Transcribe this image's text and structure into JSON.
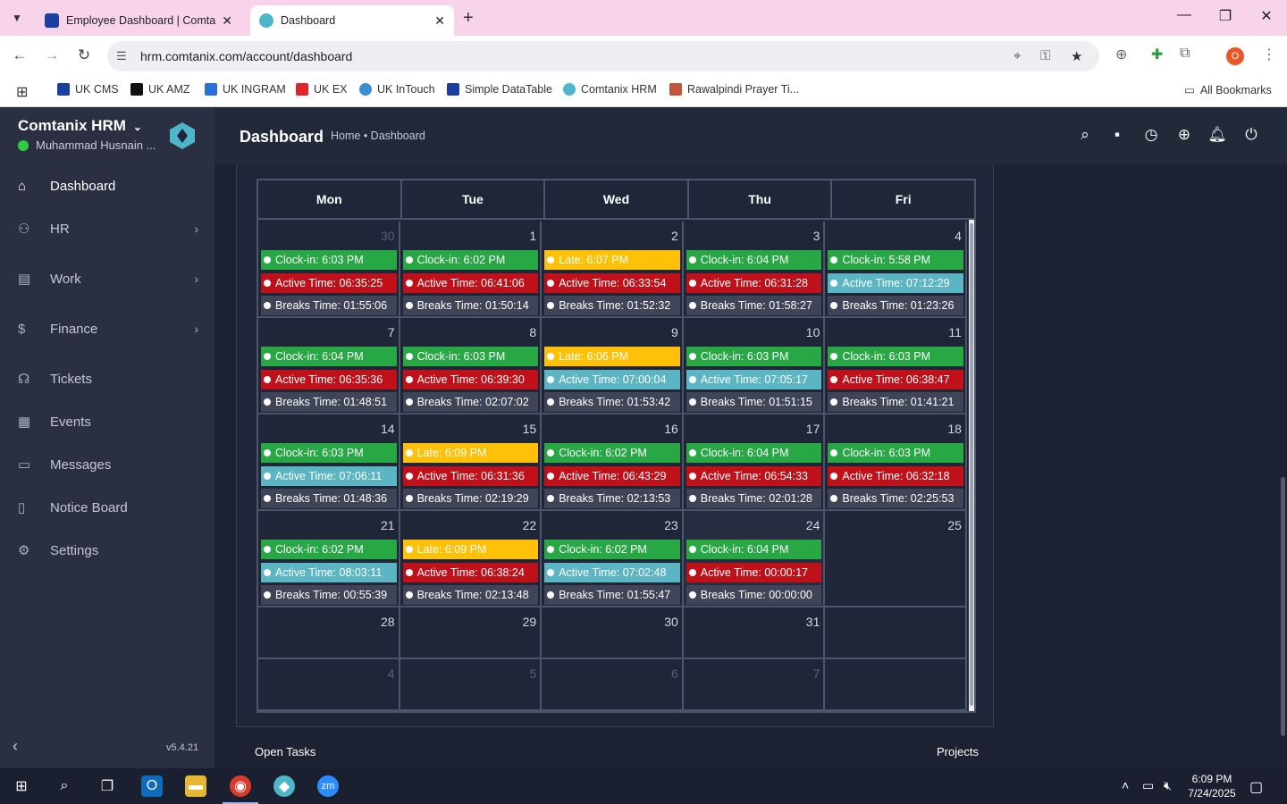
{
  "browser": {
    "tabs": [
      {
        "title": "Employee Dashboard | Comtan",
        "active": false
      },
      {
        "title": "Dashboard",
        "active": true
      }
    ],
    "url": "hrm.comtanix.com/account/dashboard",
    "bookmarks": [
      "UK CMS",
      "UK AMZ",
      "UK INGRAM",
      "UK EX",
      "UK InTouch",
      "Simple DataTable",
      "Comtanix HRM",
      "Rawalpindi Prayer Ti..."
    ],
    "all_bookmarks": "All Bookmarks",
    "profile_initial": "O"
  },
  "sidebar": {
    "brand": "Comtanix HRM",
    "user": "Muhammad Husnain ...",
    "items": [
      {
        "label": "Dashboard",
        "icon": "home-icon"
      },
      {
        "label": "HR",
        "icon": "users-icon"
      },
      {
        "label": "Work",
        "icon": "briefcase-icon"
      },
      {
        "label": "Finance",
        "icon": "dollar-icon"
      },
      {
        "label": "Tickets",
        "icon": "headset-icon"
      },
      {
        "label": "Events",
        "icon": "calendar-icon"
      },
      {
        "label": "Messages",
        "icon": "message-icon"
      },
      {
        "label": "Notice Board",
        "icon": "clipboard-icon"
      },
      {
        "label": "Settings",
        "icon": "gear-icon"
      }
    ],
    "version": "v5.4.21"
  },
  "header": {
    "title": "Dashboard",
    "breadcrumb": "Home • Dashboard"
  },
  "calendar": {
    "weekdays": [
      "Mon",
      "Tue",
      "Wed",
      "Thu",
      "Fri"
    ],
    "weeks": [
      [
        {
          "day": "30",
          "dim": true,
          "events": [
            [
              "green",
              "Clock-in: 6:03 PM"
            ],
            [
              "red",
              "Active Time: 06:35:25"
            ],
            [
              "gray",
              "Breaks Time: 01:55:06"
            ]
          ]
        },
        {
          "day": "1",
          "events": [
            [
              "green",
              "Clock-in: 6:02 PM"
            ],
            [
              "red",
              "Active Time: 06:41:06"
            ],
            [
              "gray",
              "Breaks Time: 01:50:14"
            ]
          ]
        },
        {
          "day": "2",
          "events": [
            [
              "yellow",
              "Late: 6:07 PM"
            ],
            [
              "red",
              "Active Time: 06:33:54"
            ],
            [
              "gray",
              "Breaks Time: 01:52:32"
            ]
          ]
        },
        {
          "day": "3",
          "events": [
            [
              "green",
              "Clock-in: 6:04 PM"
            ],
            [
              "red",
              "Active Time: 06:31:28"
            ],
            [
              "gray",
              "Breaks Time: 01:58:27"
            ]
          ]
        },
        {
          "day": "4",
          "events": [
            [
              "green",
              "Clock-in: 5:58 PM"
            ],
            [
              "teal",
              "Active Time: 07:12:29"
            ],
            [
              "gray",
              "Breaks Time: 01:23:26"
            ]
          ]
        }
      ],
      [
        {
          "day": "7",
          "events": [
            [
              "green",
              "Clock-in: 6:04 PM"
            ],
            [
              "red",
              "Active Time: 06:35:36"
            ],
            [
              "gray",
              "Breaks Time: 01:48:51"
            ]
          ]
        },
        {
          "day": "8",
          "events": [
            [
              "green",
              "Clock-in: 6:03 PM"
            ],
            [
              "red",
              "Active Time: 06:39:30"
            ],
            [
              "gray",
              "Breaks Time: 02:07:02"
            ]
          ]
        },
        {
          "day": "9",
          "events": [
            [
              "yellow",
              "Late: 6:06 PM"
            ],
            [
              "teal",
              "Active Time: 07:00:04"
            ],
            [
              "gray",
              "Breaks Time: 01:53:42"
            ]
          ]
        },
        {
          "day": "10",
          "events": [
            [
              "green",
              "Clock-in: 6:03 PM"
            ],
            [
              "teal",
              "Active Time: 07:05:17"
            ],
            [
              "gray",
              "Breaks Time: 01:51:15"
            ]
          ]
        },
        {
          "day": "11",
          "events": [
            [
              "green",
              "Clock-in: 6:03 PM"
            ],
            [
              "red",
              "Active Time: 06:38:47"
            ],
            [
              "gray",
              "Breaks Time: 01:41:21"
            ]
          ]
        }
      ],
      [
        {
          "day": "14",
          "events": [
            [
              "green",
              "Clock-in: 6:03 PM"
            ],
            [
              "teal",
              "Active Time: 07:06:11"
            ],
            [
              "gray",
              "Breaks Time: 01:48:36"
            ]
          ]
        },
        {
          "day": "15",
          "events": [
            [
              "yellow",
              "Late: 6:09 PM"
            ],
            [
              "red",
              "Active Time: 06:31:36"
            ],
            [
              "gray",
              "Breaks Time: 02:19:29"
            ]
          ]
        },
        {
          "day": "16",
          "events": [
            [
              "green",
              "Clock-in: 6:02 PM"
            ],
            [
              "red",
              "Active Time: 06:43:29"
            ],
            [
              "gray",
              "Breaks Time: 02:13:53"
            ]
          ]
        },
        {
          "day": "17",
          "events": [
            [
              "green",
              "Clock-in: 6:04 PM"
            ],
            [
              "red",
              "Active Time: 06:54:33"
            ],
            [
              "gray",
              "Breaks Time: 02:01:28"
            ]
          ]
        },
        {
          "day": "18",
          "events": [
            [
              "green",
              "Clock-in: 6:03 PM"
            ],
            [
              "red",
              "Active Time: 06:32:18"
            ],
            [
              "gray",
              "Breaks Time: 02:25:53"
            ]
          ]
        }
      ],
      [
        {
          "day": "21",
          "events": [
            [
              "green",
              "Clock-in: 6:02 PM"
            ],
            [
              "teal",
              "Active Time: 08:03:11"
            ],
            [
              "gray",
              "Breaks Time: 00:55:39"
            ]
          ]
        },
        {
          "day": "22",
          "events": [
            [
              "yellow",
              "Late: 6:09 PM"
            ],
            [
              "red",
              "Active Time: 06:38:24"
            ],
            [
              "gray",
              "Breaks Time: 02:13:48"
            ]
          ]
        },
        {
          "day": "23",
          "events": [
            [
              "green",
              "Clock-in: 6:02 PM"
            ],
            [
              "teal",
              "Active Time: 07:02:48"
            ],
            [
              "gray",
              "Breaks Time: 01:55:47"
            ]
          ]
        },
        {
          "day": "24",
          "today": true,
          "events": [
            [
              "green",
              "Clock-in: 6:04 PM"
            ],
            [
              "red",
              "Active Time: 00:00:17"
            ],
            [
              "gray",
              "Breaks Time: 00:00:00"
            ]
          ]
        },
        {
          "day": "25",
          "events": []
        }
      ],
      [
        {
          "day": "28",
          "events": []
        },
        {
          "day": "29",
          "events": []
        },
        {
          "day": "30",
          "events": []
        },
        {
          "day": "31",
          "events": []
        },
        {
          "day": "",
          "events": []
        }
      ],
      [
        {
          "day": "4",
          "dim": true,
          "events": []
        },
        {
          "day": "5",
          "dim": true,
          "events": []
        },
        {
          "day": "6",
          "dim": true,
          "events": []
        },
        {
          "day": "7",
          "dim": true,
          "events": []
        },
        {
          "day": "",
          "events": []
        }
      ]
    ]
  },
  "footer_panels": {
    "open_tasks": "Open Tasks",
    "projects": "Projects"
  },
  "taskbar": {
    "time": "6:09 PM",
    "date": "7/24/2025"
  }
}
